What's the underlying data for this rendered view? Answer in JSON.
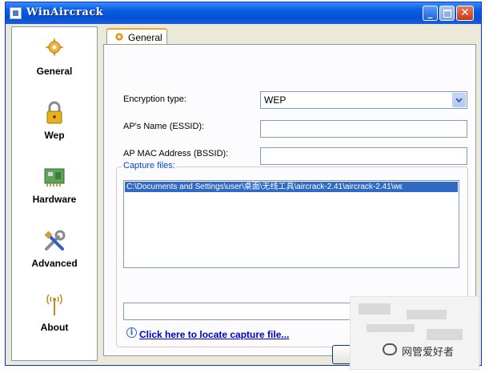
{
  "window": {
    "title": "WinAircrack"
  },
  "sidebar": {
    "items": [
      {
        "label": "General",
        "icon": "general-icon"
      },
      {
        "label": "Wep",
        "icon": "lock-icon"
      },
      {
        "label": "Hardware",
        "icon": "hardware-icon"
      },
      {
        "label": "Advanced",
        "icon": "tools-icon"
      },
      {
        "label": "About",
        "icon": "antenna-icon"
      }
    ]
  },
  "tab": {
    "label": "General"
  },
  "form": {
    "encryption_label": "Encryption type:",
    "encryption_value": "WEP",
    "essid_label": "AP's Name (ESSID):",
    "essid_value": "",
    "bssid_label": "AP MAC Address (BSSID):",
    "bssid_value": ""
  },
  "capture": {
    "group_title": "Capture files:",
    "files": [
      "C:\\Documents and Settings\\user\\桌面\\无线工具\\aircrack-2.41\\aircrack-2.41\\wε"
    ],
    "path_value": "",
    "link_text": "Click here to locate capture file..."
  },
  "watermark": {
    "text": "网管爱好者"
  },
  "colors": {
    "title_bar": "#0551d6",
    "selection": "#316ac5",
    "link": "#0000cc",
    "group_title": "#0046d5"
  }
}
